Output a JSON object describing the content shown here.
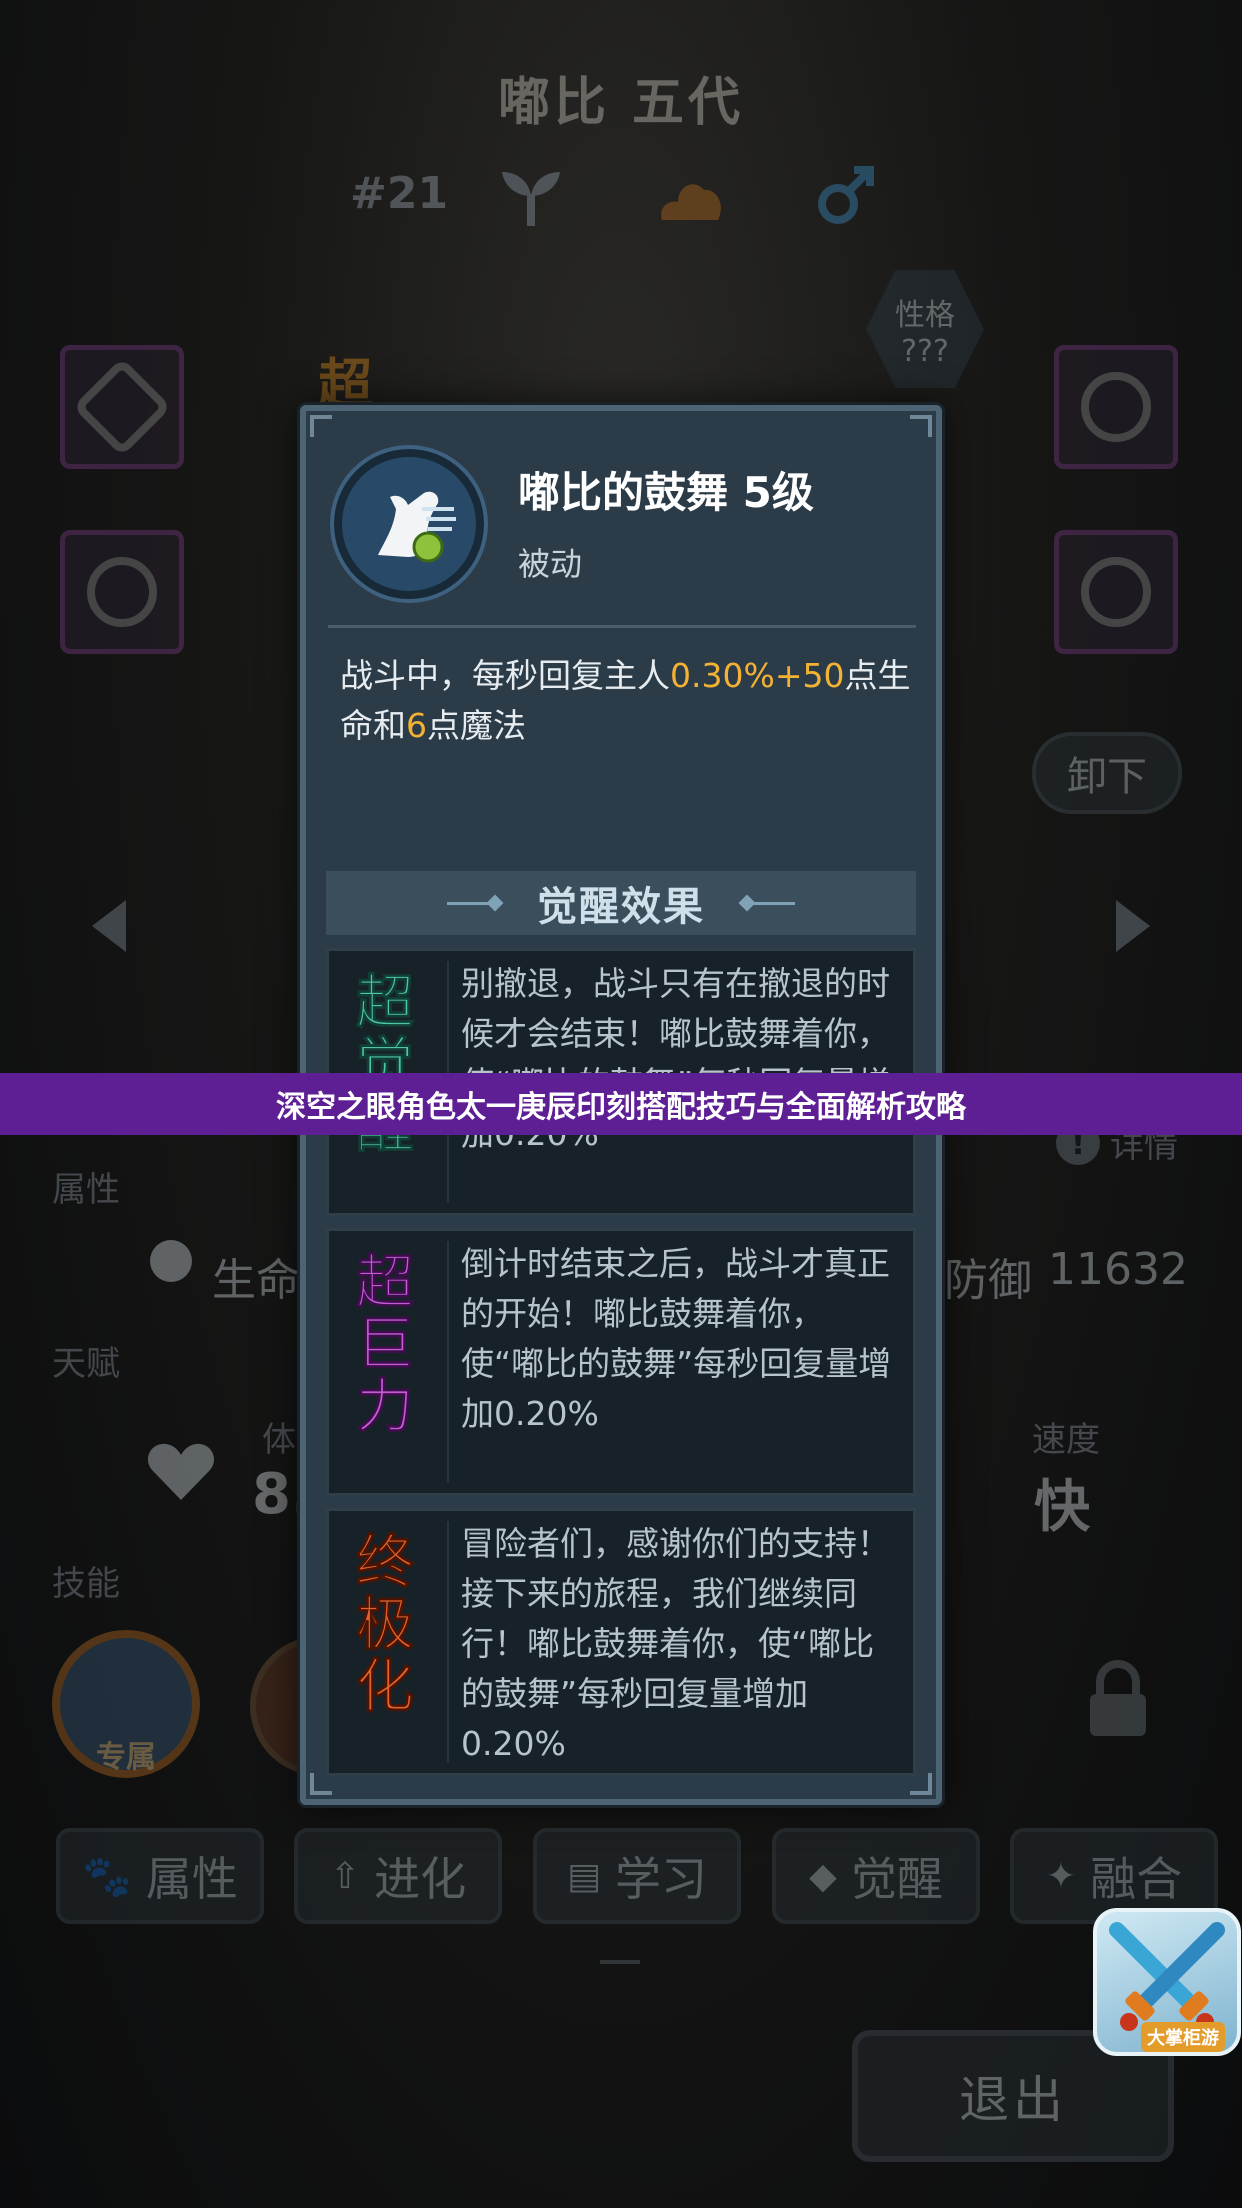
{
  "banner": {
    "text": "深空之眼角色太一庚辰印刻搭配技巧与全面解析攻略"
  },
  "background": {
    "pet_name": "嘟比 五代",
    "pet_number": "#21",
    "personality_label": "性格",
    "personality_value": "???",
    "unequip_button": "卸下",
    "rarity_char": "超",
    "detail_link": "详情",
    "section_attributes": "属性",
    "hp_label": "生命",
    "defense_label": "防御",
    "defense_value": "11632",
    "section_talent": "天赋",
    "stamina_label": "体",
    "stamina_value_visible": "8.",
    "speed_label": "速度",
    "speed_value": "快",
    "section_skills": "技能",
    "exclusive_badge": "专属",
    "tabs": [
      {
        "icon": "paw-icon",
        "label": "属性"
      },
      {
        "icon": "evolve-arrow-icon",
        "label": "进化"
      },
      {
        "icon": "book-icon",
        "label": "学习"
      },
      {
        "icon": "awaken-icon",
        "label": "觉醒"
      },
      {
        "icon": "fusion-icon",
        "label": "融合"
      }
    ],
    "exit_button": "退出",
    "logo_text": "大掌柜游"
  },
  "modal": {
    "skill_name": "嘟比的鼓舞 5级",
    "skill_type": "被动",
    "description": {
      "part1": "战斗中，每秒回复主人",
      "highlight1": "0.30%+50",
      "part2": "点生命和",
      "highlight2": "6",
      "part3": "点魔法"
    },
    "awaken_header": "觉醒效果",
    "awaken_effects": [
      {
        "badge": [
          "超",
          "觉",
          "醒"
        ],
        "badge_color": "#4fc7a6",
        "text": "别撤退，战斗只有在撤退的时候才会结束！嘟比鼓舞着你，使“嘟比的鼓舞”每秒回复量增加0.20%"
      },
      {
        "badge": [
          "超",
          "巨",
          "力"
        ],
        "badge_color": "#c659d8",
        "text": "倒计时结束之后，战斗才真正的开始！嘟比鼓舞着你，使“嘟比的鼓舞”每秒回复量增加0.20%"
      },
      {
        "badge": [
          "终",
          "极",
          "化"
        ],
        "badge_color": "#e0632d",
        "text": "冒险者们，感谢你们的支持！接下来的旅程，我们继续同行！嘟比鼓舞着你，使“嘟比的鼓舞”每秒回复量增加0.20%"
      }
    ]
  },
  "colors": {
    "highlight": "#f3b233",
    "banner": "#5e1f95",
    "modal_bg": "#2b3b47"
  }
}
